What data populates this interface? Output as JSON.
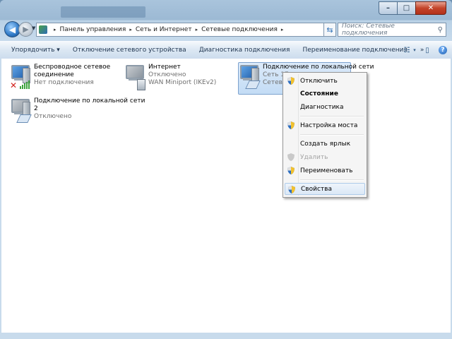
{
  "window": {
    "caption_minimize": "–",
    "caption_maximize": "□",
    "caption_close": "✕"
  },
  "nav": {
    "back_glyph": "◀",
    "forward_glyph": "▶",
    "breadcrumb": [
      "Панель управления",
      "Сеть и Интернет",
      "Сетевые подключения"
    ],
    "breadcrumb_sep": "▸",
    "search_placeholder": "Поиск: Сетевые подключения"
  },
  "toolbar": {
    "items": [
      "Упорядочить ▾",
      "Отключение сетевого устройства",
      "Диагностика подключения",
      "Переименование подключения",
      "»"
    ]
  },
  "connections": [
    {
      "name_line1": "Беспроводное сетевое",
      "name_line2": "соединение",
      "status": "Нет подключения",
      "icon": "wireless-network-icon"
    },
    {
      "name_line1": "Интернет",
      "name_line2": "Отключено",
      "status": "WAN Miniport (IKEv2)",
      "icon": "wan-miniport-icon"
    },
    {
      "name_line1": "Подключение по локальной сети",
      "name_line2": "Сеть  17",
      "status": "Сетевой",
      "icon": "lan-connection-icon"
    },
    {
      "name_line1": "Подключение по локальной сети",
      "name_line2": "2",
      "status": "Отключено",
      "icon": "lan-connection-icon"
    }
  ],
  "context_menu": {
    "items": [
      {
        "label": "Отключить",
        "shield": true,
        "bold": false,
        "disabled": false
      },
      {
        "label": "Состояние",
        "shield": false,
        "bold": true,
        "disabled": false
      },
      {
        "label": "Диагностика",
        "shield": false,
        "bold": false,
        "disabled": false
      },
      {
        "label": "Настройка моста",
        "shield": true,
        "bold": false,
        "disabled": false
      },
      {
        "label": "Создать ярлык",
        "shield": false,
        "bold": false,
        "disabled": false
      },
      {
        "label": "Удалить",
        "shield": true,
        "bold": false,
        "disabled": true
      },
      {
        "label": "Переименовать",
        "shield": true,
        "bold": false,
        "disabled": false
      },
      {
        "label": "Свойства",
        "shield": true,
        "bold": false,
        "disabled": false
      }
    ]
  },
  "colors": {
    "accent": "#2f79c6",
    "selection": "#c3dcf5",
    "error_red": "#d2231d",
    "signal_green": "#3ca33c"
  }
}
